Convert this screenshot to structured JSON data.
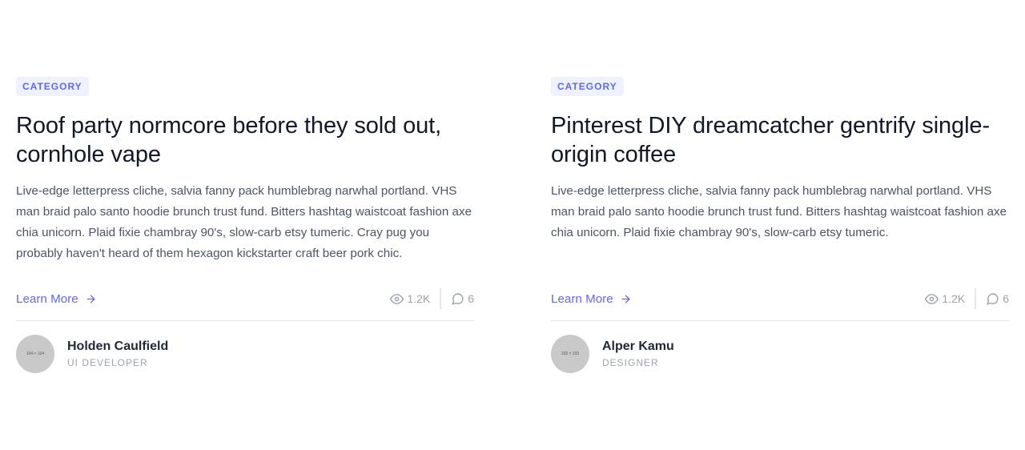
{
  "cards": [
    {
      "category": "CATEGORY",
      "title": "Roof party normcore before they sold out, cornhole vape",
      "description": "Live-edge letterpress cliche, salvia fanny pack humblebrag narwhal portland. VHS man braid palo santo hoodie brunch trust fund. Bitters hashtag waistcoat fashion axe chia unicorn. Plaid fixie chambray 90's, slow-carb etsy tumeric. Cray pug you probably haven't heard of them hexagon kickstarter craft beer pork chic.",
      "learn_more": "Learn More",
      "views": "1.2K",
      "comments": "6",
      "author": {
        "avatar_text": "104 × 104",
        "name": "Holden Caulfield",
        "role": "UI DEVELOPER"
      }
    },
    {
      "category": "CATEGORY",
      "title": "Pinterest DIY dreamcatcher gentrify single-origin coffee",
      "description": "Live-edge letterpress cliche, salvia fanny pack humblebrag narwhal portland. VHS man braid palo santo hoodie brunch trust fund. Bitters hashtag waistcoat fashion axe chia unicorn. Plaid fixie chambray 90's, slow-carb etsy tumeric.",
      "learn_more": "Learn More",
      "views": "1.2K",
      "comments": "6",
      "author": {
        "avatar_text": "103 × 103",
        "name": "Alper Kamu",
        "role": "DESIGNER"
      }
    }
  ],
  "colors": {
    "accent": "#6366f1",
    "badge_bg": "#eef2ff",
    "muted": "#9ca3af",
    "body_text": "#4b5563",
    "heading": "#111827"
  },
  "icons": {
    "learn_more": "arrow-right-icon",
    "views": "eye-icon",
    "comments": "speech-bubble-icon"
  }
}
